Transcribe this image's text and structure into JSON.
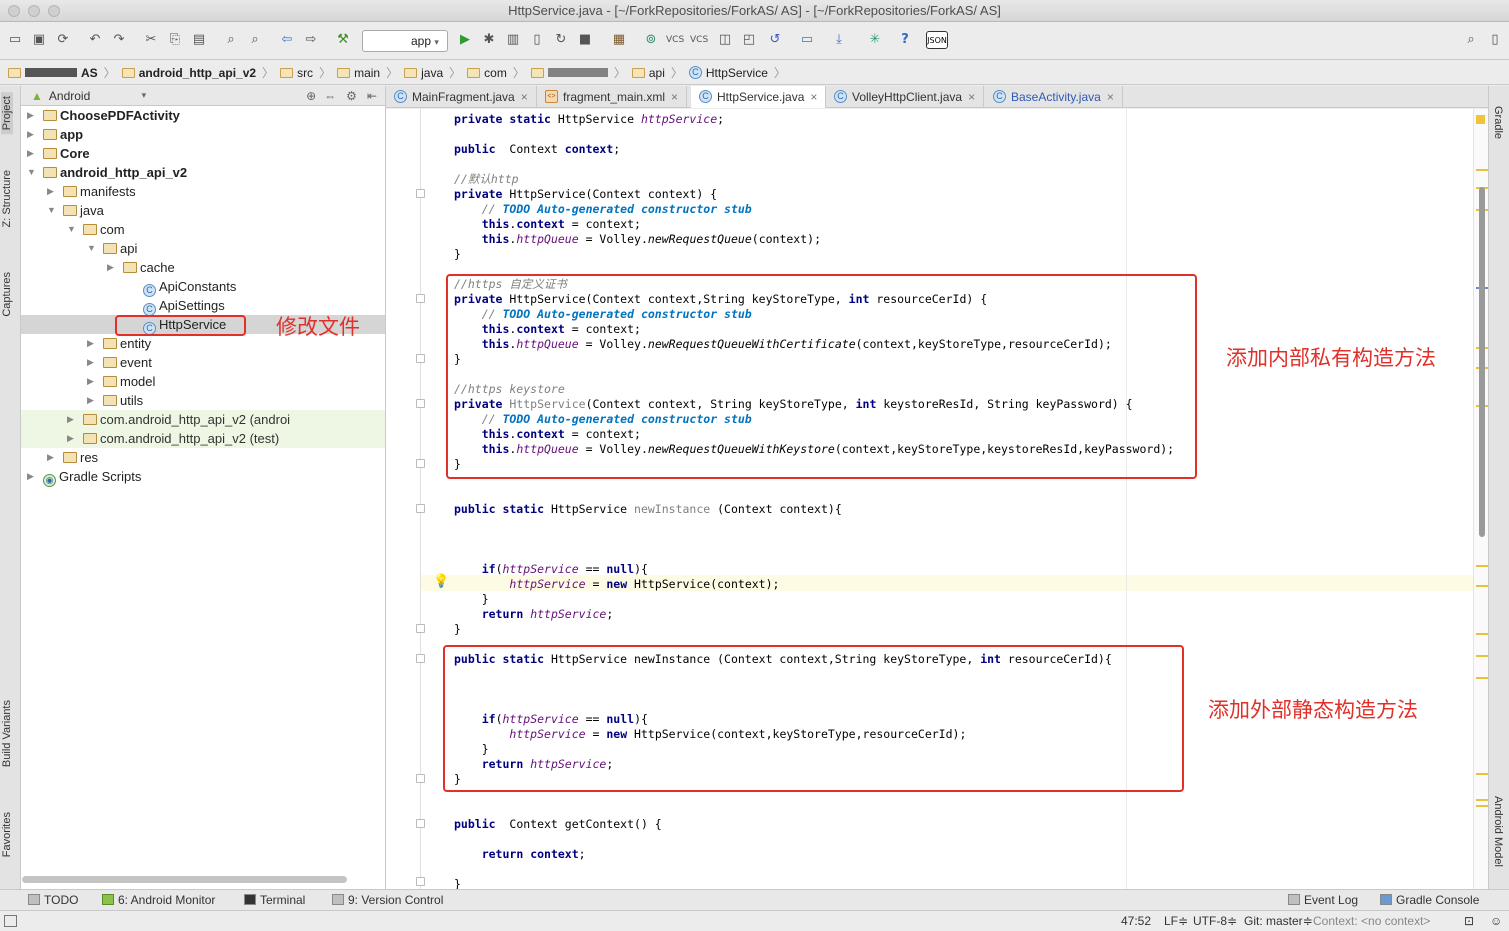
{
  "window": {
    "title": "HttpService.java - [~/ForkRepositories/ForkAS/",
    "title_suffix": "AS] - [~/ForkRepositories/ForkAS/  AS]"
  },
  "toolbar": {
    "run_config": "app"
  },
  "breadcrumb": [
    "AS",
    "android_http_api_v2",
    "src",
    "main",
    "java",
    "com",
    "api",
    "HttpService"
  ],
  "project_panel": {
    "view_mode": "Android",
    "tree": [
      {
        "label": "ChoosePDFActivity",
        "level": 0,
        "kind": "module",
        "expanded": false
      },
      {
        "label": "app",
        "level": 0,
        "kind": "module",
        "expanded": false
      },
      {
        "label": "Core",
        "level": 0,
        "kind": "module",
        "expanded": false
      },
      {
        "label": "android_http_api_v2",
        "level": 0,
        "kind": "module",
        "expanded": true
      },
      {
        "label": "manifests",
        "level": 1,
        "kind": "folder",
        "expanded": false
      },
      {
        "label": "java",
        "level": 1,
        "kind": "folder",
        "expanded": true
      },
      {
        "label": "com",
        "level": 2,
        "kind": "package",
        "expanded": true
      },
      {
        "label": "api",
        "level": 3,
        "kind": "package",
        "expanded": true
      },
      {
        "label": "cache",
        "level": 4,
        "kind": "package",
        "expanded": false
      },
      {
        "label": "ApiConstants",
        "level": 5,
        "kind": "class"
      },
      {
        "label": "ApiSettings",
        "level": 5,
        "kind": "class"
      },
      {
        "label": "HttpService",
        "level": 5,
        "kind": "class",
        "selected": true
      },
      {
        "label": "entity",
        "level": 3,
        "kind": "package",
        "expanded": false
      },
      {
        "label": "event",
        "level": 3,
        "kind": "package",
        "expanded": false
      },
      {
        "label": "model",
        "level": 3,
        "kind": "package",
        "expanded": false
      },
      {
        "label": "utils",
        "level": 3,
        "kind": "package",
        "expanded": false
      },
      {
        "label": "com.android_http_api_v2 (androi",
        "level": 2,
        "kind": "package",
        "expanded": false,
        "test": true
      },
      {
        "label": "com.android_http_api_v2 (test)",
        "level": 2,
        "kind": "package",
        "expanded": false,
        "test": true
      },
      {
        "label": "res",
        "level": 1,
        "kind": "folder",
        "expanded": false
      },
      {
        "label": "Gradle Scripts",
        "level": 0,
        "kind": "gradle",
        "expanded": false
      }
    ]
  },
  "editor_tabs": [
    {
      "label": "MainFragment.java",
      "active": false
    },
    {
      "label": "fragment_main.xml",
      "active": false
    },
    {
      "label": "HttpService.java",
      "active": true
    },
    {
      "label": "VolleyHttpClient.java",
      "active": false
    },
    {
      "label": "BaseActivity.java",
      "active": false
    }
  ],
  "annotations": {
    "modify_file": "修改文件",
    "add_private_ctor": "添加内部私有构造方法",
    "add_static_ctor": "添加外部静态构造方法"
  },
  "side_tabs": {
    "left": [
      "Project",
      "Z: Structure",
      "Captures",
      "Build Variants",
      "Favorites"
    ],
    "right": [
      "Gradle",
      "Android Model"
    ]
  },
  "bottom_tools": [
    "TODO",
    "6: Android Monitor",
    "Terminal",
    "9: Version Control",
    "Event Log",
    "Gradle Console"
  ],
  "status": {
    "position": "47:52",
    "line_sep": "LF≑",
    "encoding": "UTF-8≑",
    "git": "Git: master≑",
    "context": "Context: <no context>"
  }
}
